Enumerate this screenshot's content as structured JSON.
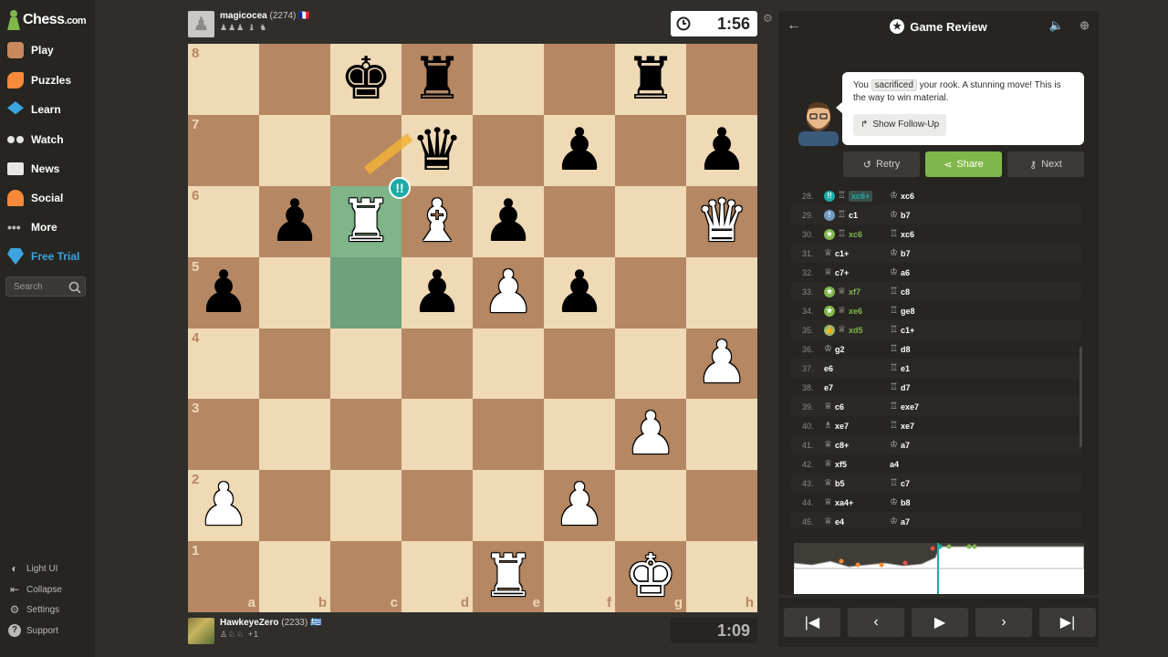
{
  "sidebar": {
    "logo": "Chess",
    "logo_suffix": ".com",
    "items": [
      {
        "label": "Play",
        "icon": "pawn-icon",
        "color": "#bab9b8"
      },
      {
        "label": "Puzzles",
        "icon": "puzzle-icon",
        "color": "#f7893a"
      },
      {
        "label": "Learn",
        "icon": "graduation-cap-icon",
        "color": "#3ca4e0"
      },
      {
        "label": "Watch",
        "icon": "binoculars-icon",
        "color": "#bab9b8"
      },
      {
        "label": "News",
        "icon": "newspaper-icon",
        "color": "#e8e7e6"
      },
      {
        "label": "Social",
        "icon": "people-icon",
        "color": "#f7893a"
      },
      {
        "label": "More",
        "icon": "ellipsis-icon",
        "color": "#bab9b8"
      }
    ],
    "free_trial": "Free Trial",
    "search_placeholder": "Search",
    "bottom": [
      "Light UI",
      "Collapse",
      "Settings",
      "Support"
    ]
  },
  "top_player": {
    "name": "magicocea",
    "rating": "(2274)",
    "flag": "🇫🇷",
    "captured": "♟♟♟ ♝ ♞",
    "clock": "1:56"
  },
  "bottom_player": {
    "name": "HawkeyeZero",
    "rating": "(2233)",
    "flag": "🇬🇷",
    "captured": "♙♘♘",
    "advantage": "+1",
    "clock": "1:09"
  },
  "board": {
    "ranks": [
      "8",
      "7",
      "6",
      "5",
      "4",
      "3",
      "2",
      "1"
    ],
    "files": [
      "a",
      "b",
      "c",
      "d",
      "e",
      "f",
      "g",
      "h"
    ],
    "position": [
      [
        "",
        "",
        "k",
        "r",
        "",
        "",
        "r",
        ""
      ],
      [
        "",
        "",
        "",
        "q",
        "",
        "p",
        "",
        "p"
      ],
      [
        "",
        "p",
        "R",
        "B",
        "p",
        "",
        "",
        "Q"
      ],
      [
        "p",
        "",
        "",
        "p",
        "P",
        "p",
        "",
        ""
      ],
      [
        "",
        "",
        "",
        "",
        "",
        "",
        "",
        "P"
      ],
      [
        "",
        "",
        "",
        "",
        "",
        "",
        "P",
        ""
      ],
      [
        "P",
        "",
        "",
        "",
        "",
        "P",
        "",
        ""
      ],
      [
        "",
        "",
        "",
        "",
        "R",
        "",
        "K",
        ""
      ]
    ],
    "brilliant_badge": "!!"
  },
  "review": {
    "title": "Game Review",
    "coach_text_1": "You ",
    "coach_keyword": "sacrificed",
    "coach_text_2": " your rook. A stunning move! This is the way to win material.",
    "follow_up": "Show Follow-Up",
    "retry": "Retry",
    "share": "Share",
    "next": "Next"
  },
  "moves": [
    {
      "n": "28.",
      "wi": "brill",
      "wp": "♖",
      "w": "xc6+",
      "wc": "brill",
      "bp": "♔",
      "b": "xc6"
    },
    {
      "n": "29.",
      "wi": "info",
      "wp": "♖",
      "w": "c1",
      "wc": "",
      "bp": "♔",
      "b": "b7"
    },
    {
      "n": "30.",
      "wi": "best",
      "wp": "♖",
      "w": "xc6",
      "wc": "good",
      "bp": "♖",
      "b": "xc6"
    },
    {
      "n": "31.",
      "wi": "",
      "wp": "♕",
      "w": "c1+",
      "wc": "",
      "bp": "♔",
      "b": "b7"
    },
    {
      "n": "32.",
      "wi": "",
      "wp": "♕",
      "w": "c7+",
      "wc": "",
      "bp": "♔",
      "b": "a6"
    },
    {
      "n": "33.",
      "wi": "best",
      "wp": "♕",
      "w": "xf7",
      "wc": "good",
      "bp": "♖",
      "b": "c8"
    },
    {
      "n": "34.",
      "wi": "best",
      "wp": "♕",
      "w": "xe6",
      "wc": "good",
      "bp": "♖",
      "b": "ge8"
    },
    {
      "n": "35.",
      "wi": "good",
      "wp": "♕",
      "w": "xd5",
      "wc": "good",
      "bp": "♖",
      "b": "c1+"
    },
    {
      "n": "36.",
      "wi": "",
      "wp": "♔",
      "w": "g2",
      "wc": "",
      "bp": "♖",
      "b": "d8"
    },
    {
      "n": "37.",
      "wi": "",
      "wp": "",
      "w": "e6",
      "wc": "",
      "bp": "♖",
      "b": "e1"
    },
    {
      "n": "38.",
      "wi": "",
      "wp": "",
      "w": "e7",
      "wc": "",
      "bp": "♖",
      "b": "d7"
    },
    {
      "n": "39.",
      "wi": "",
      "wp": "♕",
      "w": "c6",
      "wc": "",
      "bp": "♖",
      "b": "exe7"
    },
    {
      "n": "40.",
      "wi": "",
      "wp": "♗",
      "w": "xe7",
      "wc": "",
      "bp": "♖",
      "b": "xe7"
    },
    {
      "n": "41.",
      "wi": "",
      "wp": "♕",
      "w": "c8+",
      "wc": "",
      "bp": "♔",
      "b": "a7"
    },
    {
      "n": "42.",
      "wi": "",
      "wp": "♕",
      "w": "xf5",
      "wc": "",
      "bp": "",
      "b": "a4"
    },
    {
      "n": "43.",
      "wi": "",
      "wp": "♕",
      "w": "b5",
      "wc": "",
      "bp": "♖",
      "b": "c7"
    },
    {
      "n": "44.",
      "wi": "",
      "wp": "♕",
      "w": "xa4+",
      "wc": "",
      "bp": "♔",
      "b": "b8"
    },
    {
      "n": "45.",
      "wi": "",
      "wp": "♕",
      "w": "e4",
      "wc": "",
      "bp": "♔",
      "b": "a7"
    }
  ],
  "colors": {
    "accent_green": "#81b64c",
    "brilliant": "#1baca6",
    "light_square": "#f0d9b5",
    "dark_square": "#b58863"
  }
}
